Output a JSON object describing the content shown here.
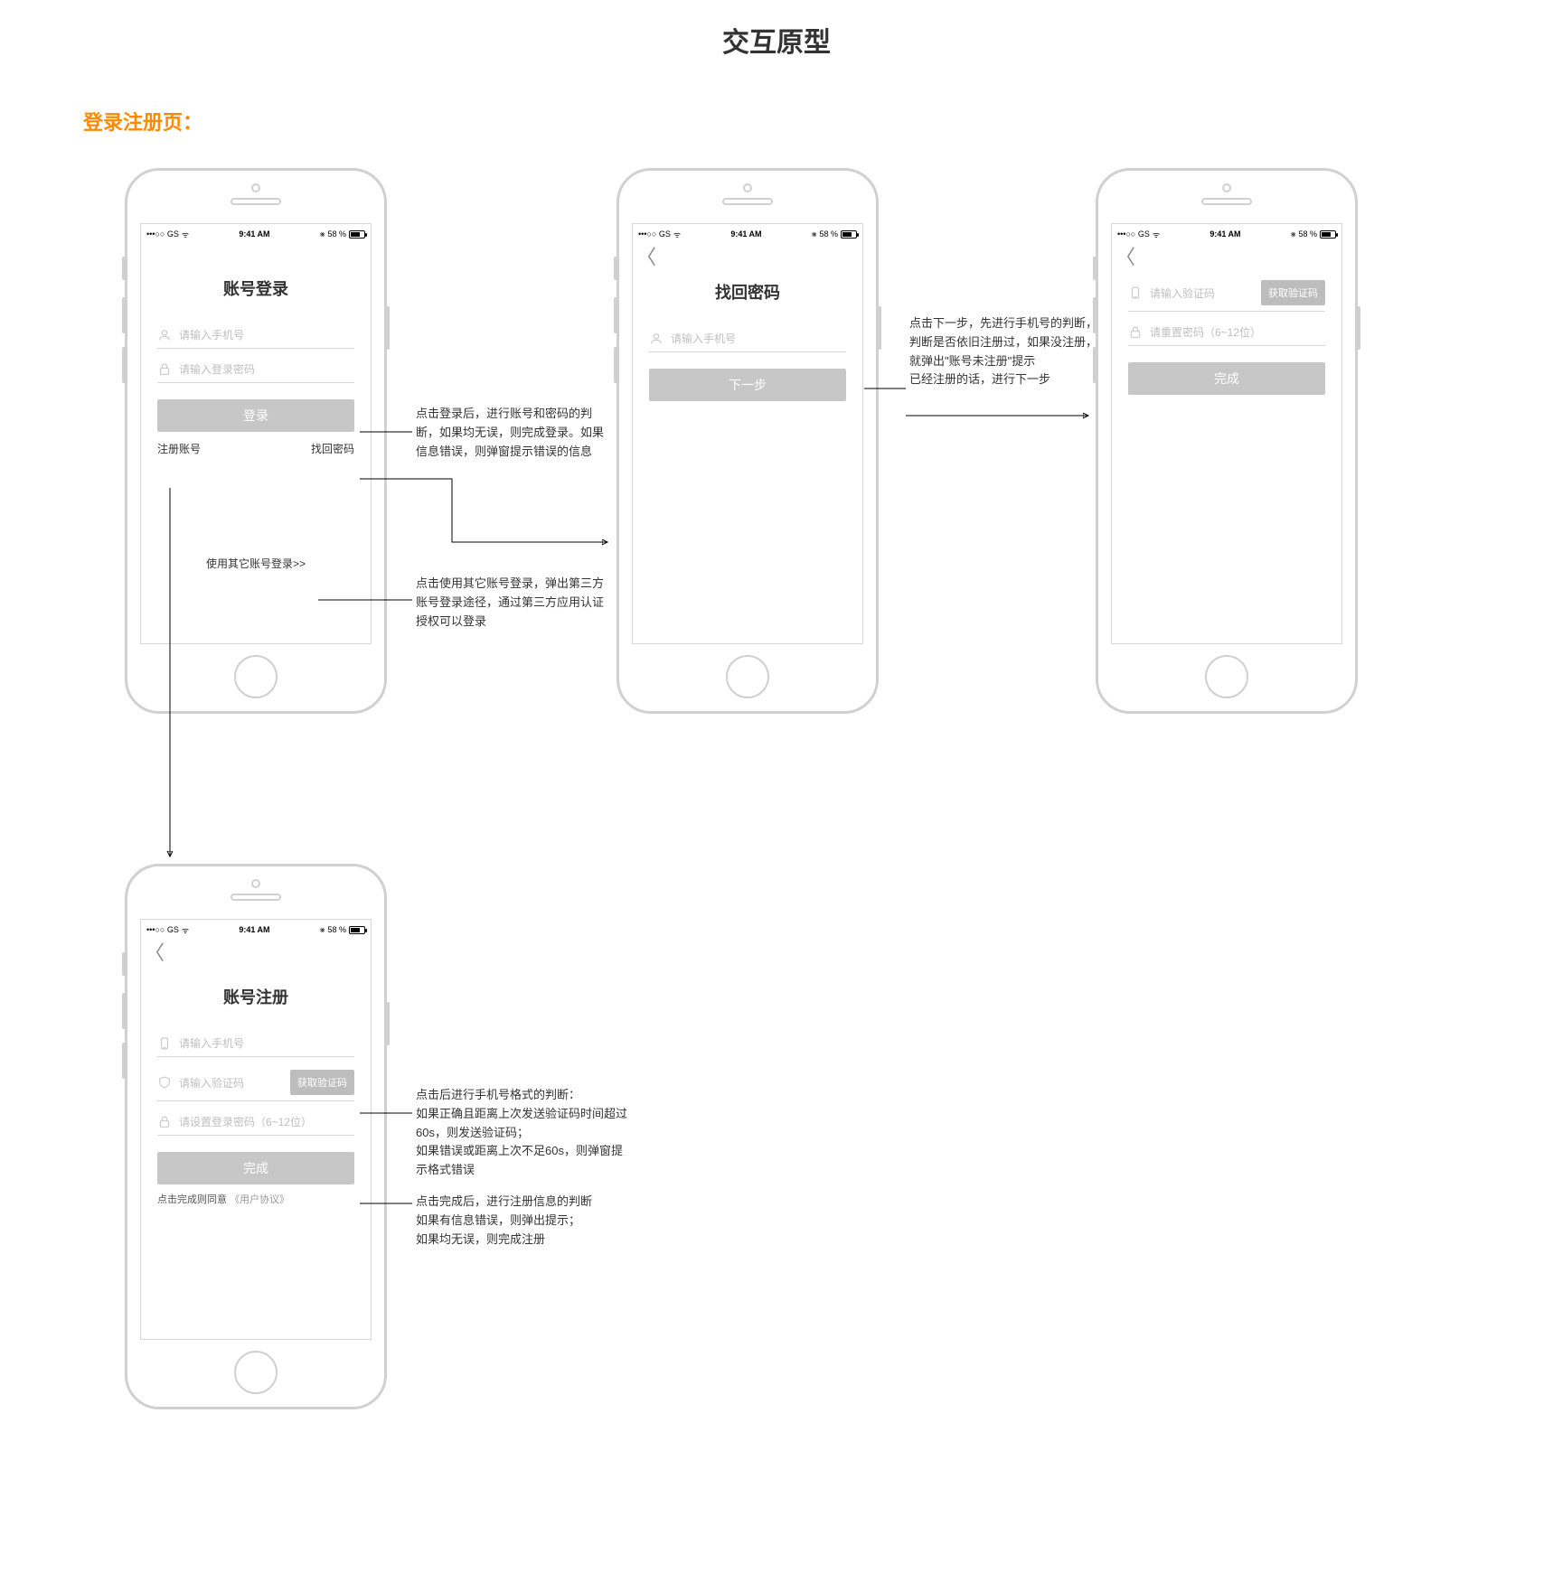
{
  "page": {
    "title": "交互原型",
    "section": "登录注册页："
  },
  "statusbar": {
    "carrier": "•••○○ GS",
    "wifi": "⌵",
    "time": "9:41 AM",
    "bt": "⚲",
    "battery": "58 %"
  },
  "login": {
    "title": "账号登录",
    "phone_ph": "请输入手机号",
    "pwd_ph": "请输入登录密码",
    "submit": "登录",
    "link_register": "注册账号",
    "link_forgot": "找回密码",
    "other": "使用其它账号登录>>"
  },
  "forgot": {
    "title": "找回密码",
    "phone_ph": "请输入手机号",
    "next": "下一步"
  },
  "reset": {
    "code_ph": "请输入验证码",
    "get_code": "获取验证码",
    "pwd_ph": "请重置密码（6~12位）",
    "done": "完成"
  },
  "register": {
    "title": "账号注册",
    "phone_ph": "请输入手机号",
    "code_ph": "请输入验证码",
    "get_code": "获取验证码",
    "pwd_ph": "请设置登录密码（6~12位）",
    "done": "完成",
    "agree_prefix": "点击完成则同意",
    "agree_link": "《用户协议》"
  },
  "notes": {
    "login_submit": "点击登录后，进行账号和密码的判断，如果均无误，则完成登录。如果信息错误，则弹窗提示错误的信息",
    "login_other": "点击使用其它账号登录，弹出第三方账号登录途径，通过第三方应用认证授权可以登录",
    "forgot_next": "点击下一步，先进行手机号的判断，判断是否依旧注册过，如果没注册，就弹出\"账号未注册\"提示\n已经注册的话，进行下一步",
    "reg_get_code": "点击后进行手机号格式的判断：\n如果正确且距离上次发送验证码时间超过60s，则发送验证码；\n如果错误或距离上次不足60s，则弹窗提示格式错误",
    "reg_done": "点击完成后，进行注册信息的判断\n如果有信息错误，则弹出提示；\n如果均无误，则完成注册"
  }
}
